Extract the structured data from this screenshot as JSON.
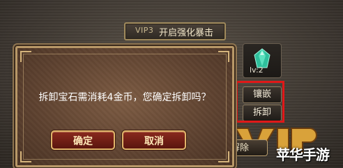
{
  "banner": {
    "vip_label": "VIP3",
    "title": "开启强化暴击"
  },
  "gem_panel": {
    "icon": "teal-gem-icon",
    "level_label": "lv:2"
  },
  "side_buttons": {
    "inlay": "镶嵌",
    "remove": "拆卸"
  },
  "bottom_button": {
    "label": "解除"
  },
  "dialog": {
    "message": "拆卸宝石需消耗4金币，您确定拆卸吗？",
    "confirm": "确定",
    "cancel": "取消"
  },
  "watermark": "苹华手游",
  "colors": {
    "highlight_box": "#e01818",
    "dialog_button": "#8a2a1e",
    "gem": "#3ad6b0"
  }
}
